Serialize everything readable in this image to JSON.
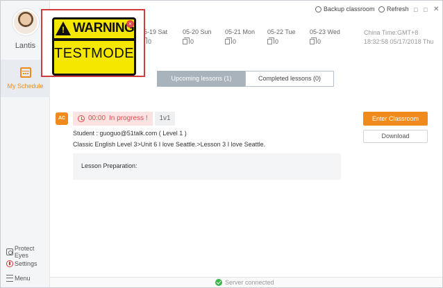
{
  "user": {
    "name": "Lantis"
  },
  "sidebar": {
    "nav": {
      "label": "My Schedule"
    },
    "bottom": [
      {
        "label": "Protect Eyes",
        "icon": "eye-icon"
      },
      {
        "label": "Settings",
        "icon": "gear-icon"
      },
      {
        "label": "Menu",
        "icon": "menu-icon"
      }
    ]
  },
  "header": {
    "backup_label": "Backup classroom",
    "refresh_label": "Refresh",
    "controls": {
      "minimize": "□",
      "maximize": "□",
      "close": "✕"
    }
  },
  "days": [
    {
      "label": "05-19 Sat",
      "count": "0"
    },
    {
      "label": "05-20 Sun",
      "count": "0"
    },
    {
      "label": "05-21 Mon",
      "count": "0"
    },
    {
      "label": "05-22 Tue",
      "count": "0"
    },
    {
      "label": "05-23 Wed",
      "count": "0"
    }
  ],
  "clock": {
    "zone": "China Time:GMT+8",
    "datetime": "18:32:58 05/17/2018 Thu"
  },
  "warning": {
    "title": "WARNING",
    "mark": "!",
    "mode": "TESTMODE",
    "close": "×"
  },
  "tabs": [
    {
      "label": "Upcoming lessons (1)",
      "active": true
    },
    {
      "label": "Completed lessons",
      "count": "(0)",
      "active": false
    }
  ],
  "lesson": {
    "icon_label": "AC",
    "time": "00:00",
    "status": "In progress !",
    "type": "1v1",
    "student": "Student : guoguo@51talk.com ( Level 1 )",
    "course": "Classic English Level 3>Unit 6 I love Seattle.>Lesson 3 I love Seattle.",
    "prep_label": "Lesson Preparation:",
    "enter_label": "Enter Classroom",
    "download_label": "Download"
  },
  "status_bar": {
    "text": "Server connected",
    "color": "#39b54a"
  },
  "colors": {
    "accent": "#f08a1c",
    "danger": "#e14b4b",
    "tab_active": "#a8b3bc"
  }
}
